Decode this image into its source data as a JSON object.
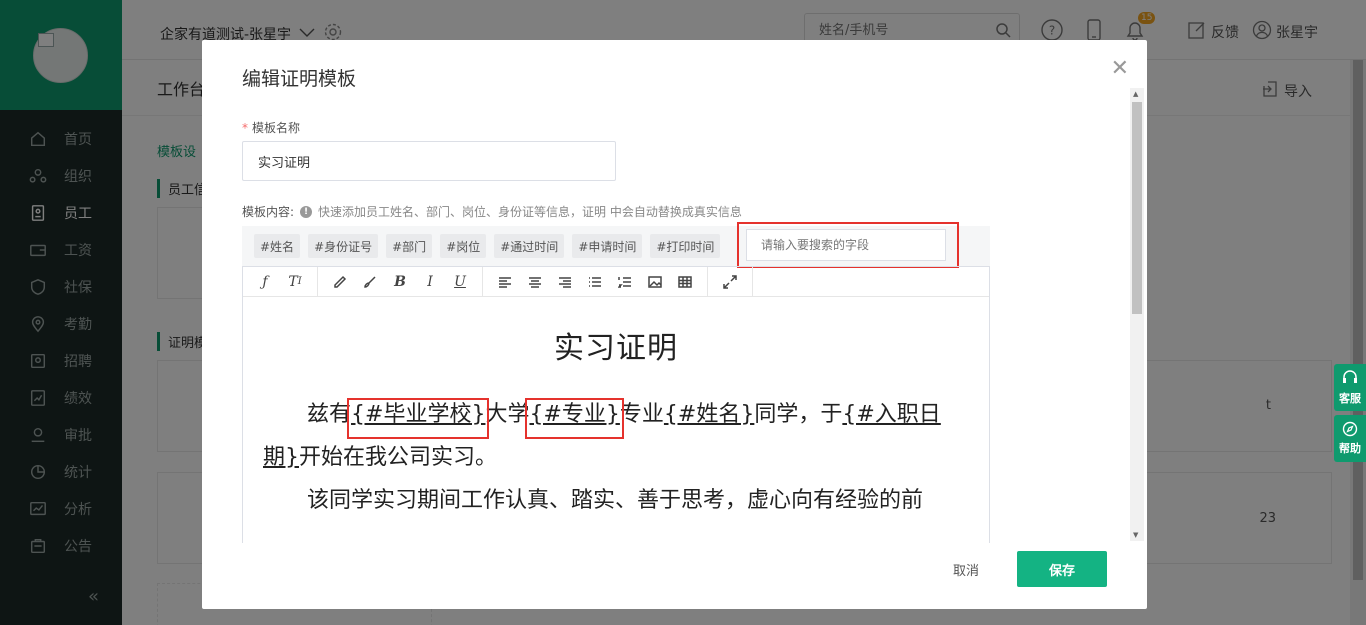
{
  "header": {
    "company": "企家有道测试-张星宇",
    "search_placeholder": "姓名/手机号",
    "notification_count": "15",
    "feedback": "反馈",
    "user_name": "张星宇"
  },
  "sidebar": {
    "items": [
      {
        "label": "首页",
        "icon": "home-icon"
      },
      {
        "label": "组织",
        "icon": "org-icon"
      },
      {
        "label": "员工",
        "icon": "employee-icon"
      },
      {
        "label": "工资",
        "icon": "wallet-icon"
      },
      {
        "label": "社保",
        "icon": "shield-icon"
      },
      {
        "label": "考勤",
        "icon": "location-icon"
      },
      {
        "label": "招聘",
        "icon": "recruit-icon"
      },
      {
        "label": "绩效",
        "icon": "performance-icon"
      },
      {
        "label": "审批",
        "icon": "approval-icon"
      },
      {
        "label": "统计",
        "icon": "pie-icon"
      },
      {
        "label": "分析",
        "icon": "analysis-icon"
      },
      {
        "label": "公告",
        "icon": "notice-icon"
      }
    ],
    "active_index": 2
  },
  "page": {
    "title": "工作台",
    "import": "导入",
    "section": "模板设",
    "sub1": "员工信",
    "sub2": "证明模",
    "card_text1": "t",
    "card_text2": "23"
  },
  "float": {
    "service": "客服",
    "help": "帮助"
  },
  "modal": {
    "title": "编辑证明模板",
    "name_label": "模板名称",
    "name_value": "实习证明",
    "content_label": "模板内容:",
    "hint": "快速添加员工姓名、部门、岗位、身份证等信息，证明 中会自动替换成真实信息",
    "tags": [
      "#姓名",
      "#身份证号",
      "#部门",
      "#岗位",
      "#通过时间",
      "#申请时间",
      "#打印时间"
    ],
    "field_search_placeholder": "请输入要搜索的字段",
    "doc": {
      "title": "实习证明",
      "p1_a": "兹有",
      "p1_var1": "{#毕业学校}",
      "p1_b": "大学",
      "p1_var2": "{#专业}",
      "p1_c": "专业",
      "p1_var3": "{#姓名}",
      "p1_d": "同学，于",
      "p1_var4": "{#入职日期}",
      "p1_e": "开始在我公司实习。",
      "p2": "该同学实习期间工作认真、踏实、善于思考，虚心向有经验的前"
    },
    "cancel": "取消",
    "save": "保存"
  },
  "colors": {
    "brand": "#0f9a6e",
    "save": "#14b383",
    "highlight": "#e5322d"
  }
}
